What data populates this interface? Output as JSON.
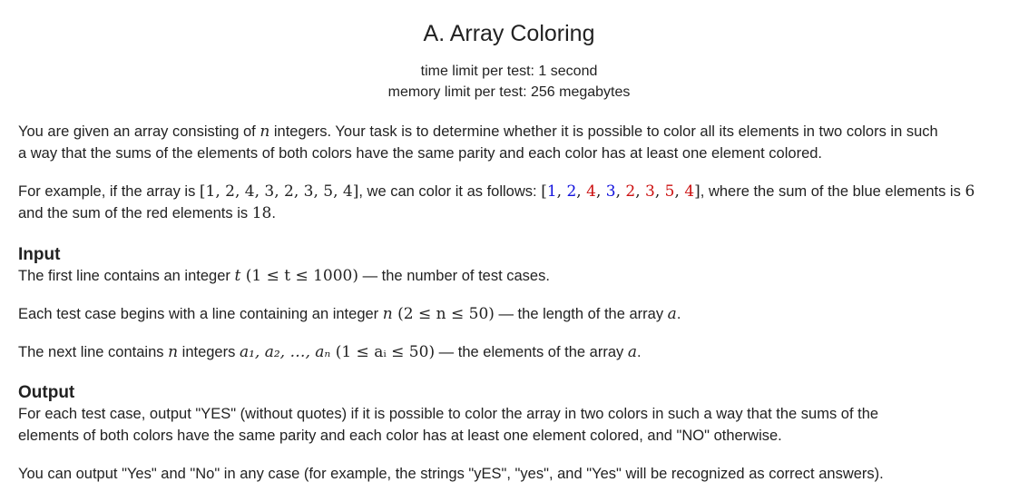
{
  "problem": {
    "title": "A. Array Coloring",
    "time_limit": "time limit per test: 1 second",
    "memory_limit": "memory limit per test: 256 megabytes"
  },
  "statement": {
    "p1_a": "You are given an array consisting of ",
    "p1_n": "n",
    "p1_b": " integers. Your task is to determine whether it is possible to color all its elements in two colors in such",
    "p1_c": "a way that the sums of the elements of both colors have the same parity and each color has at least one element colored.",
    "p2_a": "For example, if the array is ",
    "p2_array": "[1, 2, 4, 3, 2, 3, 5, 4]",
    "p2_b": ", we can color it as follows: ",
    "colored_elements": [
      {
        "value": "1",
        "color": "blue"
      },
      {
        "value": "2",
        "color": "blue"
      },
      {
        "value": "4",
        "color": "red"
      },
      {
        "value": "3",
        "color": "blue"
      },
      {
        "value": "2",
        "color": "red"
      },
      {
        "value": "3",
        "color": "red"
      },
      {
        "value": "5",
        "color": "red"
      },
      {
        "value": "4",
        "color": "red"
      }
    ],
    "p2_c": ", where the sum of the blue elements is ",
    "blue_sum": "6",
    "p2_d": "and the sum of the red elements is ",
    "red_sum": "18",
    "p2_end": "."
  },
  "input": {
    "title": "Input",
    "l1_a": "The first line contains an integer ",
    "l1_var": "t",
    "l1_range": "(1 ≤ t ≤ 1000)",
    "l1_b": " — the number of test cases.",
    "l2_a": "Each test case begins with a line containing an integer ",
    "l2_var": "n",
    "l2_range": "(2 ≤ n ≤ 50)",
    "l2_b": " — the length of the array ",
    "l2_arr": "a",
    "l2_end": ".",
    "l3_a": "The next line contains ",
    "l3_var": "n",
    "l3_b": " integers ",
    "l3_seq": "a₁, a₂, …, aₙ",
    "l3_range": "(1 ≤ aᵢ ≤ 50)",
    "l3_c": " — the elements of the array ",
    "l3_arr": "a",
    "l3_end": "."
  },
  "output": {
    "title": "Output",
    "p1_a": "For each test case, output \"YES\" (without quotes) if it is possible to color the array in two colors in such a way that the sums of the",
    "p1_b": "elements of both colors have the same parity and each color has at least one element colored, and \"NO\" otherwise.",
    "p2": "You can output \"Yes\" and \"No\" in any case (for example, the strings \"yES\", \"yes\", and \"Yes\" will be recognized as correct answers)."
  },
  "colors": {
    "blue": "#1111dd",
    "red": "#cc1111",
    "text": "#222222"
  }
}
